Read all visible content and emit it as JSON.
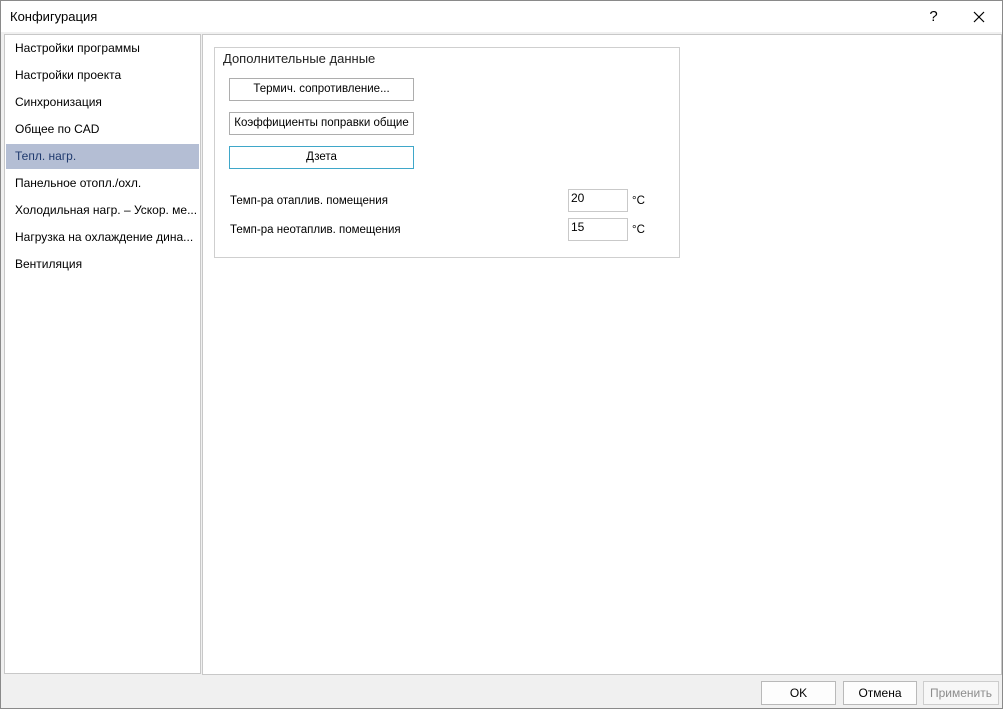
{
  "window": {
    "title": "Конфигурация",
    "help_glyph": "?"
  },
  "sidebar": {
    "items": [
      {
        "label": "Настройки программы"
      },
      {
        "label": "Настройки проекта"
      },
      {
        "label": "Синхронизация"
      },
      {
        "label": "Общее по CAD"
      },
      {
        "label": "Тепл. нагр.",
        "selected": true
      },
      {
        "label": "Панельное отопл./охл."
      },
      {
        "label": "Холодильная нагр. – Ускор. ме..."
      },
      {
        "label": "Нагрузка на охлаждение дина..."
      },
      {
        "label": "Вентиляция"
      }
    ]
  },
  "main": {
    "group_title": "Дополнительные данные",
    "buttons": {
      "thermal_resistance": "Термич. сопротивление...",
      "correction_factors": "Коэффициенты поправки общие",
      "zeta": "Дзета"
    },
    "fields": {
      "heated_room_temp": {
        "label": "Темп-ра отаплив. помещения",
        "value": "20",
        "unit": "°C"
      },
      "unheated_room_temp": {
        "label": "Темп-ра неотаплив. помещения",
        "value": "15",
        "unit": "°C"
      }
    }
  },
  "footer": {
    "ok": "OK",
    "cancel": "Отмена",
    "apply": "Применить"
  },
  "colors": {
    "selected_item_bg": "#b4bed4",
    "focused_button_border": "#3fa7c9"
  }
}
